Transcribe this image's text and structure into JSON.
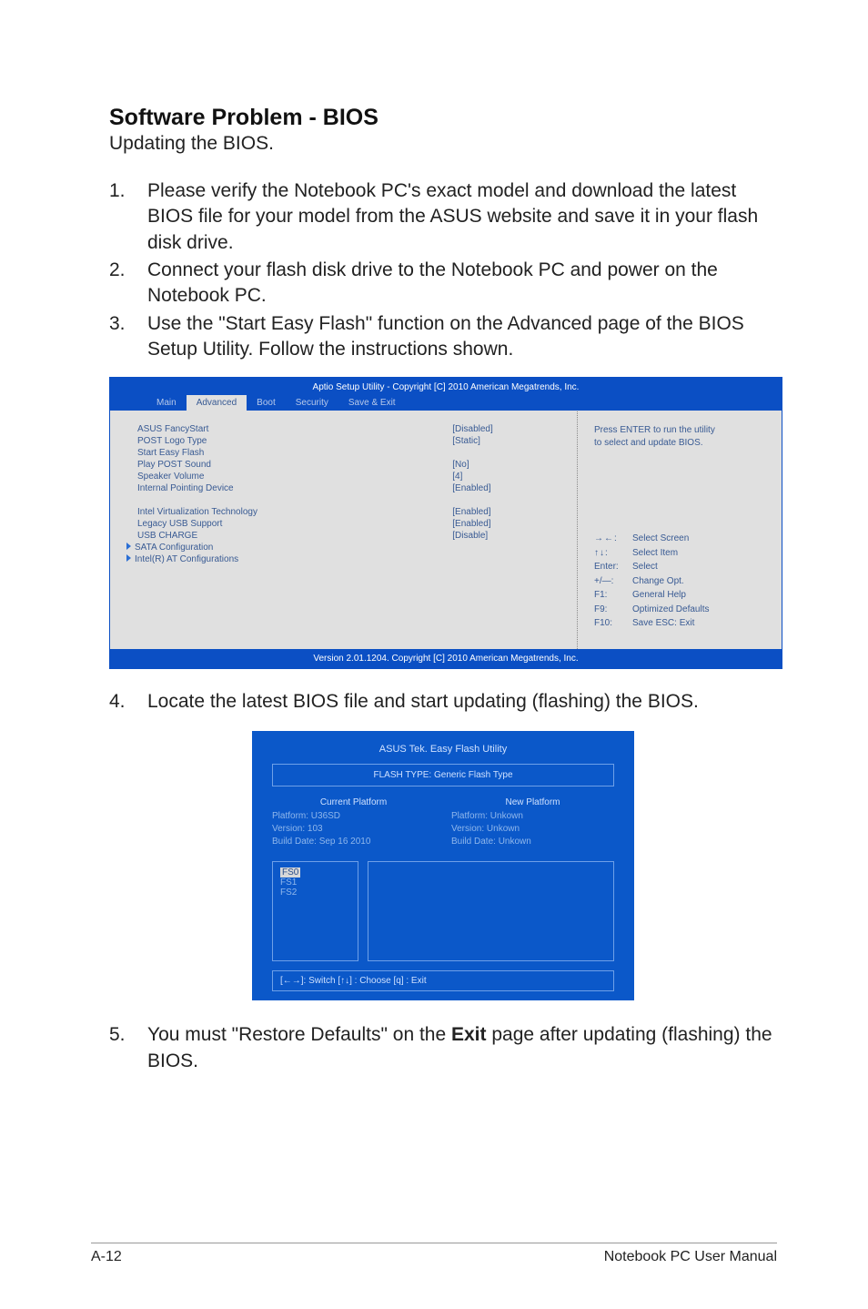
{
  "heading": "Software Problem - BIOS",
  "subheading": "Updating the BIOS.",
  "steps": {
    "s1_num": "1.",
    "s1": "Please verify the Notebook PC's exact model and download the latest BIOS file for your model from the ASUS website and save it in your flash disk drive.",
    "s2_num": "2.",
    "s2": "Connect your flash disk drive to the Notebook PC and power on the Notebook PC.",
    "s3_num": "3.",
    "s3": "Use the \"Start Easy Flash\" function on the Advanced page of the BIOS Setup Utility. Follow the instructions shown.",
    "s4_num": "4.",
    "s4": "Locate the latest BIOS file and start updating (flashing) the BIOS.",
    "s5_num": "5.",
    "s5_a": "You must \"Restore Defaults\" on the ",
    "s5_b": "Exit",
    "s5_c": " page after updating (flashing) the BIOS."
  },
  "bios1": {
    "title": "Aptio Setup Utility - Copyright [C] 2010 American Megatrends, Inc.",
    "tabs": [
      "Main",
      "Advanced",
      "Boot",
      "Security",
      "Save & Exit"
    ],
    "active_tab": "Advanced",
    "rows": [
      {
        "k": "ASUS FancyStart",
        "v": "[Disabled]"
      },
      {
        "k": "POST Logo Type",
        "v": "[Static]"
      },
      {
        "k": "Start Easy Flash",
        "v": ""
      },
      {
        "k": "Play POST Sound",
        "v": "[No]"
      },
      {
        "k": "Speaker Volume",
        "v": "[4]"
      },
      {
        "k": "Internal Pointing Device",
        "v": "[Enabled]"
      },
      {
        "k": "",
        "v": ""
      },
      {
        "k": "Intel Virtualization Technology",
        "v": "[Enabled]"
      },
      {
        "k": "Legacy USB Support",
        "v": "[Enabled]"
      },
      {
        "k": "USB CHARGE",
        "v": "[Disable]"
      }
    ],
    "submenus": [
      "SATA Configuration",
      "Intel(R) AT Configurations"
    ],
    "help_top_1": "Press ENTER to run the utility",
    "help_top_2": "to select and update BIOS.",
    "keys": {
      "k1": "→←:",
      "v1": "Select Screen",
      "k2": "↑↓:",
      "v2": "Select Item",
      "k3": "Enter:",
      "v3": "Select",
      "k4": "+/—:",
      "v4": "Change Opt.",
      "k5": "F1:",
      "v5": "General Help",
      "k6": "F9:",
      "v6": "Optimized Defaults",
      "k7": "F10:",
      "v7": "Save    ESC: Exit"
    },
    "footer": "Version 2.01.1204. Copyright [C] 2010 American Megatrends, Inc."
  },
  "bios2": {
    "title": "ASUS Tek. Easy Flash Utility",
    "flashtype": "FLASH TYPE: Generic Flash Type",
    "cur_h": "Current Platform",
    "cur_l1": "Platform:   U36SD",
    "cur_l2": "Version:     103",
    "cur_l3": "Build Date: Sep 16 2010",
    "new_h": "New Platform",
    "new_l1": "Platform:   Unkown",
    "new_l2": "Version:     Unkown",
    "new_l3": "Build Date: Unkown",
    "fs_sel": "FS0",
    "fs1": "FS1",
    "fs2": "FS2",
    "hint": "[←→]: Switch   [↑↓] : Choose   [q] : Exit"
  },
  "footer": {
    "left": "A-12",
    "right": "Notebook PC User Manual"
  }
}
